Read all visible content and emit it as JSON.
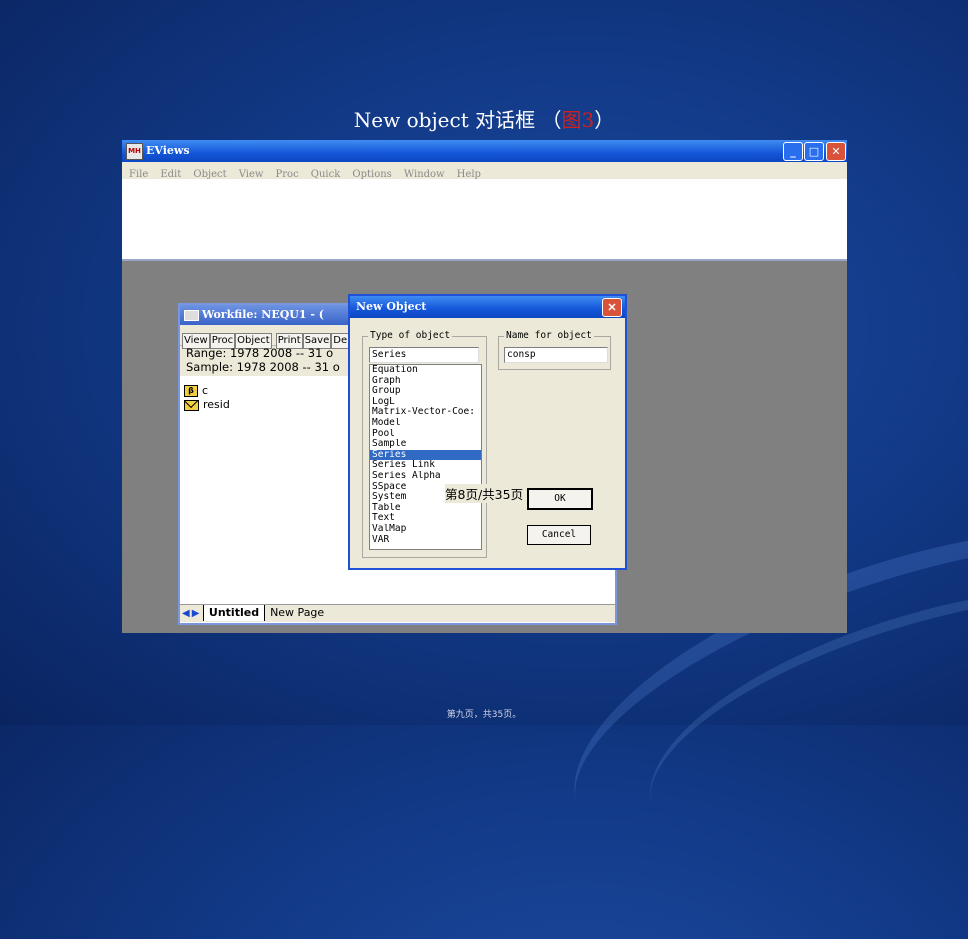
{
  "slide": {
    "title_prefix": "New object ",
    "title_cn": "对话框 （",
    "title_ref": "图3",
    "title_suffix": "）",
    "footer": "第九页，共35页。"
  },
  "app": {
    "title": "EViews",
    "icon_text": "MH",
    "menu": [
      "File",
      "Edit",
      "Object",
      "View",
      "Proc",
      "Quick",
      "Options",
      "Window",
      "Help"
    ]
  },
  "workfile": {
    "title": "Workfile: NEQU1 - (",
    "toolbar": [
      "View",
      "Proc",
      "Object",
      "Print",
      "Save",
      "De"
    ],
    "range_line": "Range:  1978 2008   --   31 o",
    "sample_line": "Sample: 1978 2008   --   31 o",
    "objects": [
      {
        "icon": "beta-icon",
        "icon_text": "β",
        "name": "c"
      },
      {
        "icon": "series-icon",
        "name": "resid"
      }
    ],
    "tabs": [
      "Untitled",
      "New Page"
    ]
  },
  "dialog": {
    "title": "New Object",
    "type_label": "Type of object",
    "type_value": "Series",
    "type_options": [
      "Equation",
      "Graph",
      "Group",
      "LogL",
      "Matrix-Vector-Coe:",
      "Model",
      "Pool",
      "Sample",
      "Series",
      "Series Link",
      "Series Alpha",
      "SSpace",
      "System",
      "Table",
      "Text",
      "ValMap",
      "VAR"
    ],
    "selected_index": 8,
    "name_label": "Name for object",
    "name_value": "consp",
    "ok_label": "OK",
    "cancel_label": "Cancel"
  },
  "overlay_text": "第8页/共35页"
}
